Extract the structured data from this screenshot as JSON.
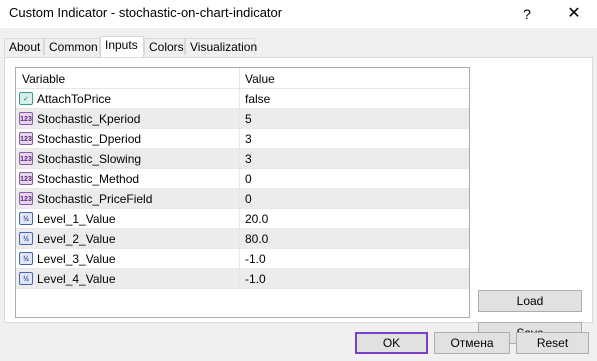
{
  "window": {
    "title": "Custom Indicator - stochastic-on-chart-indicator",
    "help_glyph": "?",
    "close_glyph": "✕"
  },
  "tabs": [
    {
      "label": "About"
    },
    {
      "label": "Common"
    },
    {
      "label": "Inputs",
      "active": true
    },
    {
      "label": "Colors"
    },
    {
      "label": "Visualization"
    }
  ],
  "table": {
    "headers": {
      "variable": "Variable",
      "value": "Value"
    },
    "rows": [
      {
        "name": "AttachToPrice",
        "value": "false",
        "type_icon": "bool-icon",
        "type_text": "✓"
      },
      {
        "name": "Stochastic_Kperiod",
        "value": "5",
        "type_icon": "int-icon",
        "type_text": "123"
      },
      {
        "name": "Stochastic_Dperiod",
        "value": "3",
        "type_icon": "int-icon",
        "type_text": "123"
      },
      {
        "name": "Stochastic_Slowing",
        "value": "3",
        "type_icon": "int-icon",
        "type_text": "123"
      },
      {
        "name": "Stochastic_Method",
        "value": "0",
        "type_icon": "int-icon",
        "type_text": "123"
      },
      {
        "name": "Stochastic_PriceField",
        "value": "0",
        "type_icon": "int-icon",
        "type_text": "123"
      },
      {
        "name": "Level_1_Value",
        "value": "20.0",
        "type_icon": "double-icon",
        "type_text": "½"
      },
      {
        "name": "Level_2_Value",
        "value": "80.0",
        "type_icon": "double-icon",
        "type_text": "½"
      },
      {
        "name": "Level_3_Value",
        "value": "-1.0",
        "type_icon": "double-icon",
        "type_text": "½"
      },
      {
        "name": "Level_4_Value",
        "value": "-1.0",
        "type_icon": "double-icon",
        "type_text": "½"
      }
    ]
  },
  "buttons": {
    "load": "Load",
    "save": "Save",
    "ok": "OK",
    "cancel": "Отмена",
    "reset": "Reset"
  },
  "colors": {
    "ok_focus_border": "#7a3fc8",
    "row_alt": "#ececec"
  }
}
